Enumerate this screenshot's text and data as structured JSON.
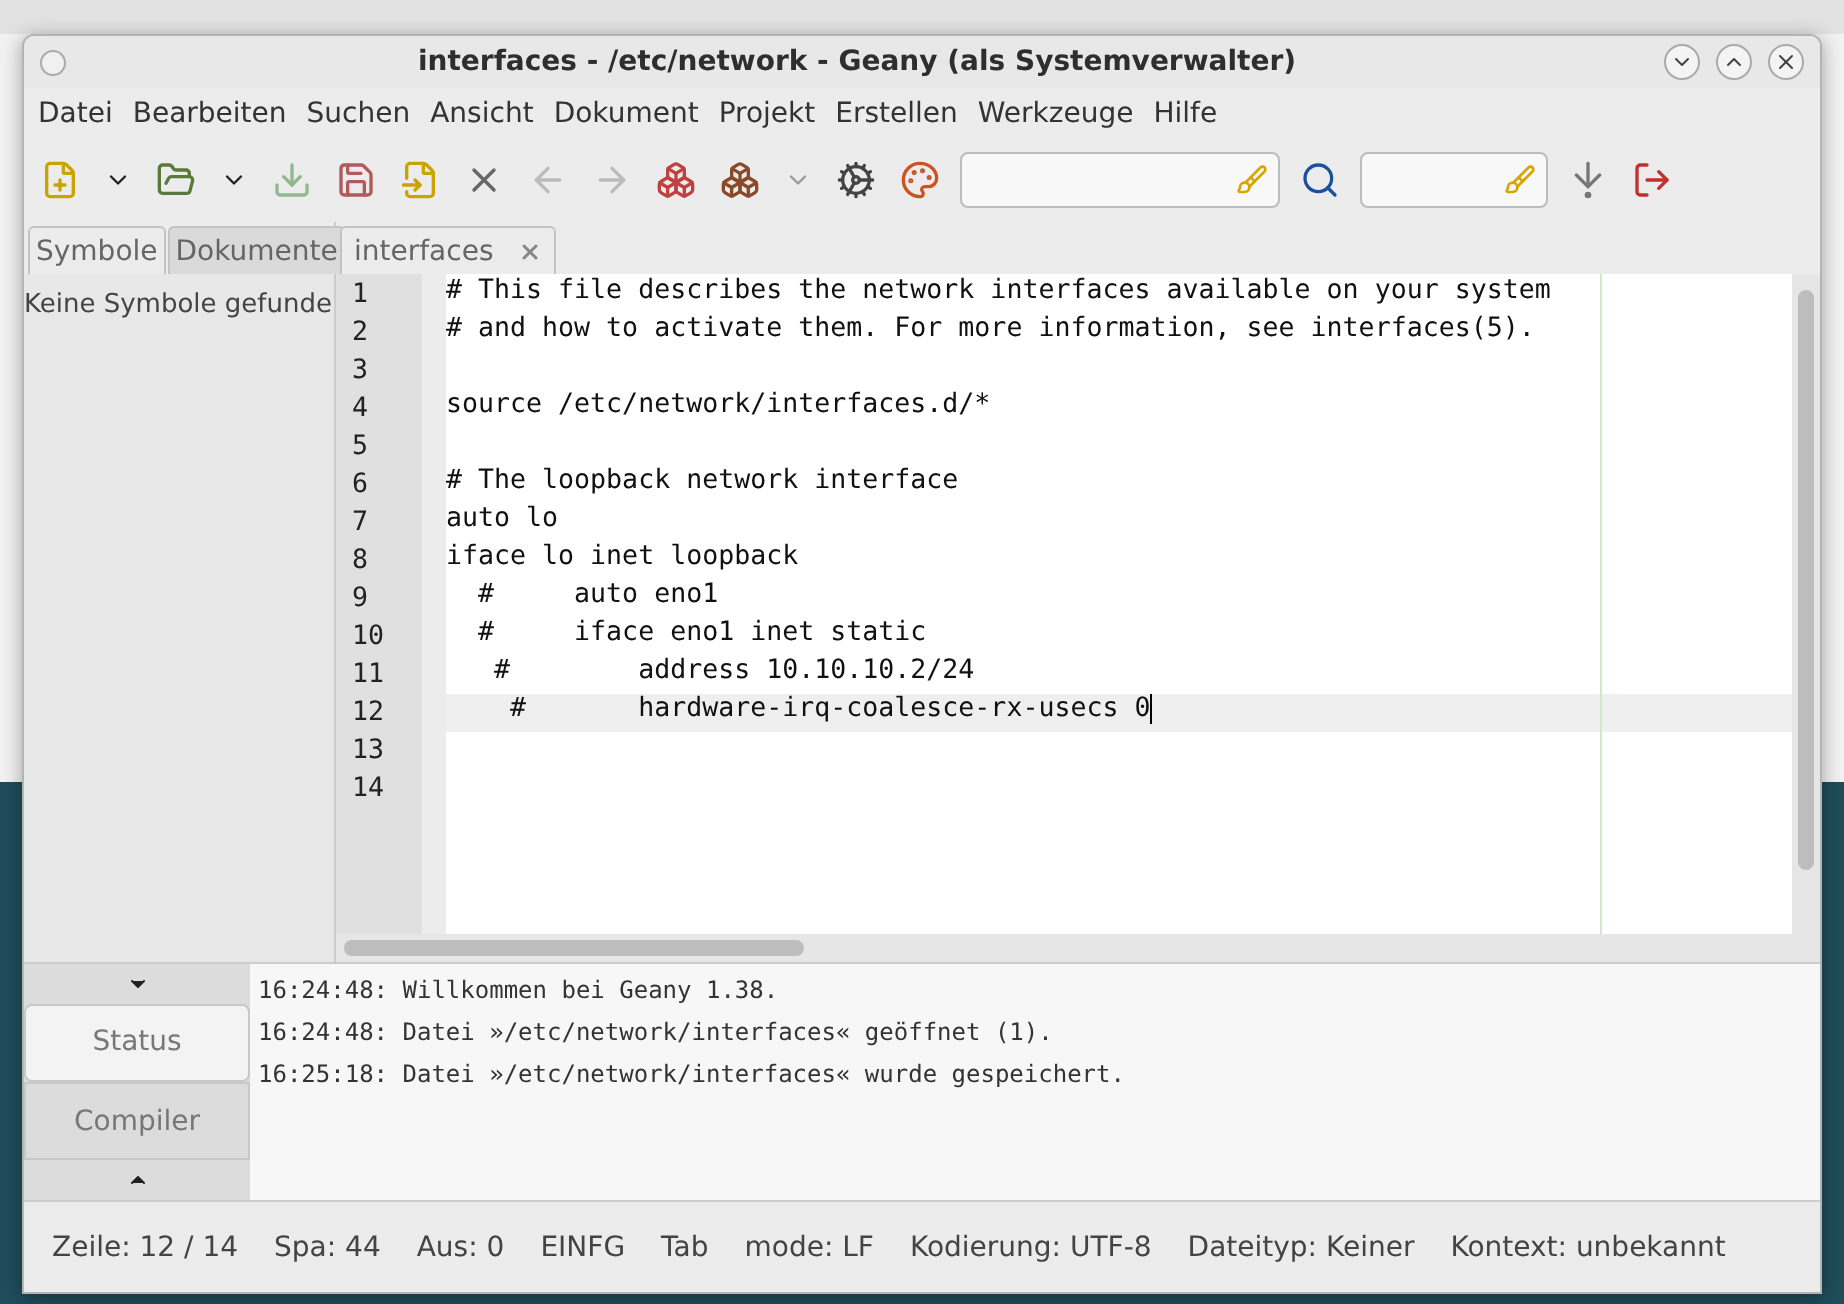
{
  "window": {
    "title": "interfaces - /etc/network - Geany (als Systemverwalter)"
  },
  "menu": [
    "Datei",
    "Bearbeiten",
    "Suchen",
    "Ansicht",
    "Dokument",
    "Projekt",
    "Erstellen",
    "Werkzeuge",
    "Hilfe"
  ],
  "sidebar": {
    "tabs": [
      {
        "label": "Symbole",
        "selected": true
      },
      {
        "label": "Dokumente",
        "selected": false
      }
    ],
    "message": "Keine Symbole gefunde"
  },
  "editor_tabs": [
    {
      "label": "interfaces",
      "selected": true
    }
  ],
  "lines": [
    {
      "number": "1",
      "text": "# This file describes the network interfaces available on your system",
      "current": false
    },
    {
      "number": "2",
      "text": "# and how to activate them. For more information, see interfaces(5).",
      "current": false
    },
    {
      "number": "3",
      "current": false
    },
    {
      "number": "4",
      "text": "source /etc/network/interfaces.d/*",
      "current": false
    },
    {
      "number": "5",
      "current": false
    },
    {
      "number": "6",
      "text": "# The loopback network interface",
      "current": false
    },
    {
      "number": "7",
      "text": "auto lo",
      "current": false
    },
    {
      "number": "8",
      "text": "iface lo inet loopback",
      "current": false
    },
    {
      "number": "9",
      "text": "  #     auto eno1",
      "current": false
    },
    {
      "number": "10",
      "text": "  #     iface eno1 inet static",
      "current": false
    },
    {
      "number": "11",
      "text": "   #        address 10.10.10.2/24",
      "current": false
    },
    {
      "number": "12",
      "text": "    #       hardware-irq-coalesce-rx-usecs 0",
      "current": true
    },
    {
      "number": "13",
      "current": false
    },
    {
      "number": "14",
      "current": false
    }
  ],
  "message_tabs": [
    {
      "label": "Status",
      "selected": true
    },
    {
      "label": "Compiler",
      "selected": false
    }
  ],
  "messages": [
    "16:24:48: Willkommen bei Geany 1.38.",
    "16:24:48: Datei »/etc/network/interfaces« geöffnet (1).",
    "16:25:18: Datei »/etc/network/interfaces« wurde gespeichert."
  ],
  "status_bar": [
    "Zeile: 12 / 14",
    "Spa: 44",
    "Aus: 0",
    "EINFG",
    "Tab",
    "mode: LF",
    "Kodierung: UTF-8",
    "Dateityp: Keiner",
    "Kontext: unbekannt"
  ]
}
